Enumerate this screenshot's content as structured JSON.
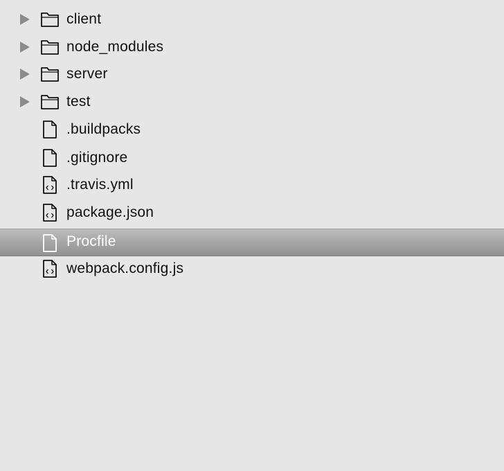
{
  "tree": {
    "items": [
      {
        "label": "client",
        "type": "folder",
        "icon": "folder-icon",
        "expandable": true
      },
      {
        "label": "node_modules",
        "type": "folder",
        "icon": "folder-icon",
        "expandable": true
      },
      {
        "label": "server",
        "type": "folder",
        "icon": "folder-icon",
        "expandable": true
      },
      {
        "label": "test",
        "type": "folder",
        "icon": "folder-icon",
        "expandable": true
      },
      {
        "label": ".buildpacks",
        "type": "file",
        "icon": "file-icon"
      },
      {
        "label": ".gitignore",
        "type": "file",
        "icon": "file-icon"
      },
      {
        "label": ".travis.yml",
        "type": "code-file",
        "icon": "code-file-icon"
      },
      {
        "label": "package.json",
        "type": "code-file",
        "icon": "code-file-icon"
      },
      {
        "label": "Procfile",
        "type": "file",
        "icon": "file-icon",
        "selected": true
      },
      {
        "label": "webpack.config.js",
        "type": "code-file",
        "icon": "code-file-icon"
      }
    ]
  },
  "colors": {
    "background": "#e6e6e6",
    "selection": "#a8a8a8",
    "text": "#111111",
    "selected_text": "#ffffff",
    "disclosure": "#8c8c8c"
  }
}
